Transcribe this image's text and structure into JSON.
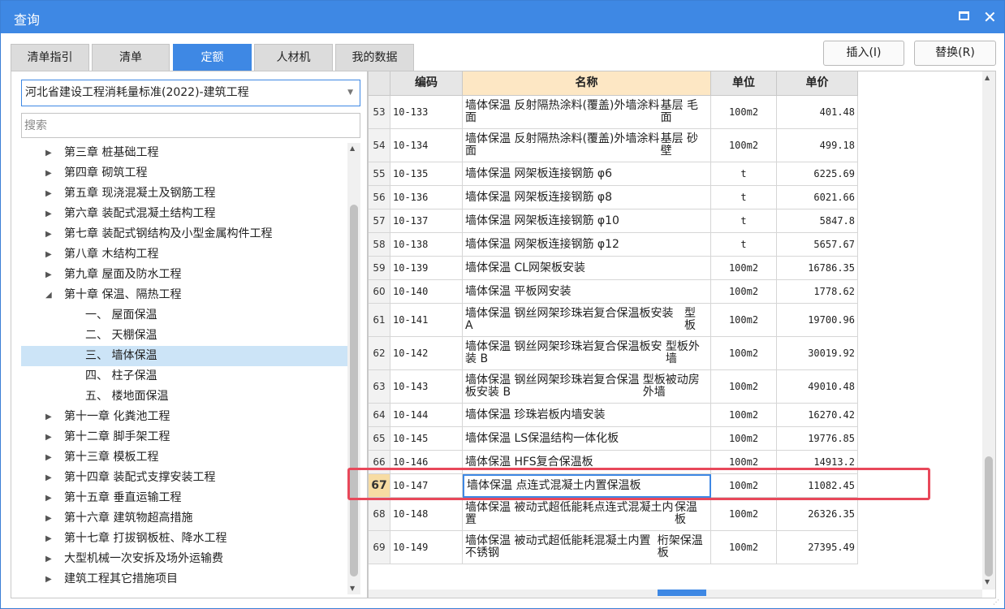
{
  "window": {
    "title": "查询",
    "maximize_icon": "maximize-icon",
    "close_icon": "close-icon"
  },
  "tabs": [
    "清单指引",
    "清单",
    "定额",
    "人材机",
    "我的数据"
  ],
  "active_tab": "定额",
  "buttons": {
    "insert": "插入(I)",
    "replace": "替换(R)"
  },
  "left": {
    "standard_select": "河北省建设工程消耗量标准(2022)-建筑工程",
    "search_placeholder": "搜索",
    "tree": [
      {
        "label": "第三章 桩基础工程",
        "expanded": false
      },
      {
        "label": "第四章 砌筑工程",
        "expanded": false
      },
      {
        "label": "第五章 现浇混凝土及钢筋工程",
        "expanded": false
      },
      {
        "label": "第六章 装配式混凝土结构工程",
        "expanded": false
      },
      {
        "label": "第七章 装配式钢结构及小型金属构件工程",
        "expanded": false
      },
      {
        "label": "第八章 木结构工程",
        "expanded": false
      },
      {
        "label": "第九章 屋面及防水工程",
        "expanded": false
      },
      {
        "label": "第十章 保温、隔热工程",
        "expanded": true
      },
      {
        "label": "一、 屋面保温",
        "child": true
      },
      {
        "label": "二、 天棚保温",
        "child": true
      },
      {
        "label": "三、 墙体保温",
        "child": true,
        "selected": true
      },
      {
        "label": "四、 柱子保温",
        "child": true
      },
      {
        "label": "五、 楼地面保温",
        "child": true
      },
      {
        "label": "第十一章 化粪池工程",
        "expanded": false
      },
      {
        "label": "第十二章 脚手架工程",
        "expanded": false
      },
      {
        "label": "第十三章 模板工程",
        "expanded": false
      },
      {
        "label": "第十四章 装配式支撑安装工程",
        "expanded": false
      },
      {
        "label": "第十五章 垂直运输工程",
        "expanded": false
      },
      {
        "label": "第十六章 建筑物超高措施",
        "expanded": false
      },
      {
        "label": "第十七章 打拔钢板桩、降水工程",
        "expanded": false
      },
      {
        "label": "大型机械一次安拆及场外运输费",
        "expanded": false
      },
      {
        "label": "建筑工程其它措施项目",
        "expanded": false
      }
    ]
  },
  "grid": {
    "headers": {
      "code": "编码",
      "name": "名称",
      "unit": "单位",
      "price": "单价"
    },
    "rows": [
      {
        "no": "53",
        "code": "10-133",
        "name": [
          "墙体保温 反射隔热涂料(覆盖)外墙涂料面",
          "基层 毛面"
        ],
        "unit": "100m2",
        "price": "401.48"
      },
      {
        "no": "54",
        "code": "10-134",
        "name": [
          "墙体保温 反射隔热涂料(覆盖)外墙涂料面",
          "基层 砂壁"
        ],
        "unit": "100m2",
        "price": "499.18"
      },
      {
        "no": "55",
        "code": "10-135",
        "name": [
          "墙体保温 网架板连接钢筋 φ6"
        ],
        "unit": "t",
        "price": "6225.69"
      },
      {
        "no": "56",
        "code": "10-136",
        "name": [
          "墙体保温 网架板连接钢筋 φ8"
        ],
        "unit": "t",
        "price": "6021.66"
      },
      {
        "no": "57",
        "code": "10-137",
        "name": [
          "墙体保温 网架板连接钢筋 φ10"
        ],
        "unit": "t",
        "price": "5847.8"
      },
      {
        "no": "58",
        "code": "10-138",
        "name": [
          "墙体保温 网架板连接钢筋 φ12"
        ],
        "unit": "t",
        "price": "5657.67"
      },
      {
        "no": "59",
        "code": "10-139",
        "name": [
          "墙体保温 CL网架板安装"
        ],
        "unit": "100m2",
        "price": "16786.35"
      },
      {
        "no": "60",
        "code": "10-140",
        "name": [
          "墙体保温 平板网安装"
        ],
        "unit": "100m2",
        "price": "1778.62"
      },
      {
        "no": "61",
        "code": "10-141",
        "name": [
          "墙体保温 钢丝网架珍珠岩复合保温板安装 A",
          "型板"
        ],
        "unit": "100m2",
        "price": "19700.96"
      },
      {
        "no": "62",
        "code": "10-142",
        "name": [
          "墙体保温 钢丝网架珍珠岩复合保温板安装 B",
          "型板外墙"
        ],
        "unit": "100m2",
        "price": "30019.92"
      },
      {
        "no": "63",
        "code": "10-143",
        "name": [
          "墙体保温 钢丝网架珍珠岩复合保温板安装 B",
          "型板被动房外墙"
        ],
        "unit": "100m2",
        "price": "49010.48"
      },
      {
        "no": "64",
        "code": "10-144",
        "name": [
          "墙体保温 珍珠岩板内墙安装"
        ],
        "unit": "100m2",
        "price": "16270.42"
      },
      {
        "no": "65",
        "code": "10-145",
        "name": [
          "墙体保温 LS保温结构一体化板"
        ],
        "unit": "100m2",
        "price": "19776.85"
      },
      {
        "no": "66",
        "code": "10-146",
        "name": [
          "墙体保温 HFS复合保温板"
        ],
        "unit": "100m2",
        "price": "14913.2"
      },
      {
        "no": "67",
        "code": "10-147",
        "name": [
          "墙体保温 点连式混凝土内置保温板"
        ],
        "unit": "100m2",
        "price": "11082.45",
        "current": true
      },
      {
        "no": "68",
        "code": "10-148",
        "name": [
          "墙体保温 被动式超低能耗点连式混凝土内置",
          "保温板"
        ],
        "unit": "100m2",
        "price": "26326.35"
      },
      {
        "no": "69",
        "code": "10-149",
        "name": [
          "墙体保温 被动式超低能耗混凝土内置不锈钢",
          "桁架保温板"
        ],
        "unit": "100m2",
        "price": "27395.49"
      }
    ]
  }
}
